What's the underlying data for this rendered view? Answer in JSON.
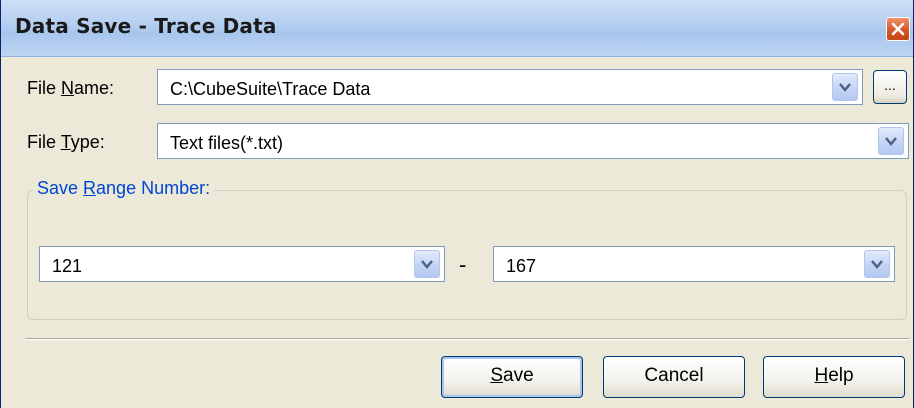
{
  "window": {
    "title": "Data Save - Trace Data",
    "close_icon": "close-icon"
  },
  "file_name": {
    "label_pre": "File ",
    "label_key": "N",
    "label_post": "ame:",
    "value": "C:\\CubeSuite\\Trace Data",
    "browse_label": "..."
  },
  "file_type": {
    "label_pre": "File ",
    "label_key": "T",
    "label_post": "ype:",
    "value": "Text files(*.txt)"
  },
  "save_range": {
    "label_pre": "Save ",
    "label_key": "R",
    "label_post": "ange Number:",
    "from_value": "121",
    "separator": "-",
    "to_value": "167"
  },
  "buttons": {
    "save_key": "S",
    "save_rest": "ave",
    "cancel": "Cancel",
    "help_key": "H",
    "help_rest": "elp"
  },
  "colors": {
    "titlebar": "#b9d2f1",
    "dialog_bg": "#ece9d8",
    "group_label": "#0046d5",
    "close_button": "#d4562a"
  }
}
